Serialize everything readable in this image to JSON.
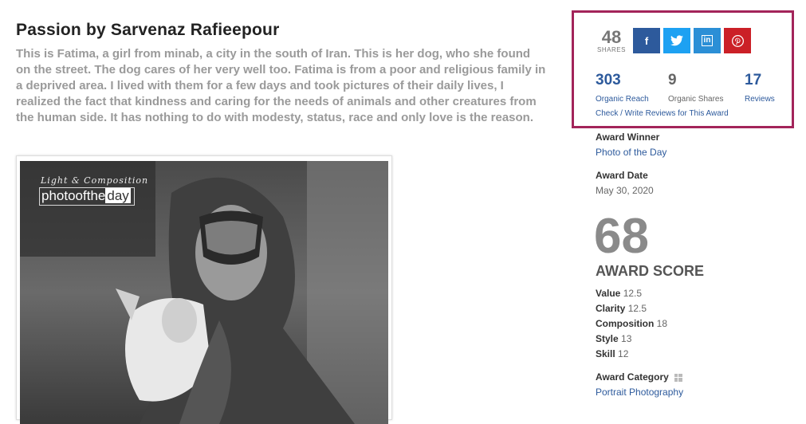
{
  "article": {
    "title": "Passion by Sarvenaz Rafieepour",
    "description": "This is Fatima, a girl from minab, a city in the south of Iran. This is her dog, who she found on the street. The dog cares of her very well too. Fatima is from a poor and religious family in a deprived area. I lived with them for a few days and took pictures of their daily lives, I realized the fact that kindness and caring for the needs of animals and other creatures from the human side. It has nothing to do with modesty, status, race and only love is the reason.",
    "watermark_top": "Light & Composition",
    "watermark_main": "photoofthe",
    "watermark_highlight": "day"
  },
  "share": {
    "count": "48",
    "count_label": "SHARES",
    "buttons": [
      {
        "name": "facebook",
        "glyph": "f",
        "color": "#2d5a9c"
      },
      {
        "name": "twitter",
        "glyph": "🐦",
        "color": "#1da1f2"
      },
      {
        "name": "linkedin",
        "glyph": "in",
        "color": "#2b8fd6"
      },
      {
        "name": "pinterest",
        "glyph": "P",
        "color": "#cb2027"
      }
    ],
    "organic_reach": {
      "value": "303",
      "label": "Organic Reach"
    },
    "organic_shares": {
      "value": "9",
      "label": "Organic Shares"
    },
    "reviews": {
      "value": "17",
      "label": "Reviews"
    },
    "reviews_link": "Check / Write Reviews for This Award",
    "border_color": "#a3245a"
  },
  "award": {
    "winner_label": "Award Winner",
    "winner_value": "Photo of the Day",
    "date_label": "Award Date",
    "date_value": "May 30, 2020",
    "score": "68",
    "score_label": "AWARD SCORE",
    "scores": [
      {
        "name": "Value",
        "value": "12.5"
      },
      {
        "name": "Clarity",
        "value": "12.5"
      },
      {
        "name": "Composition",
        "value": "18"
      },
      {
        "name": "Style",
        "value": "13"
      },
      {
        "name": "Skill",
        "value": "12"
      }
    ],
    "category_label": "Award Category",
    "category_value": "Portrait Photography"
  }
}
